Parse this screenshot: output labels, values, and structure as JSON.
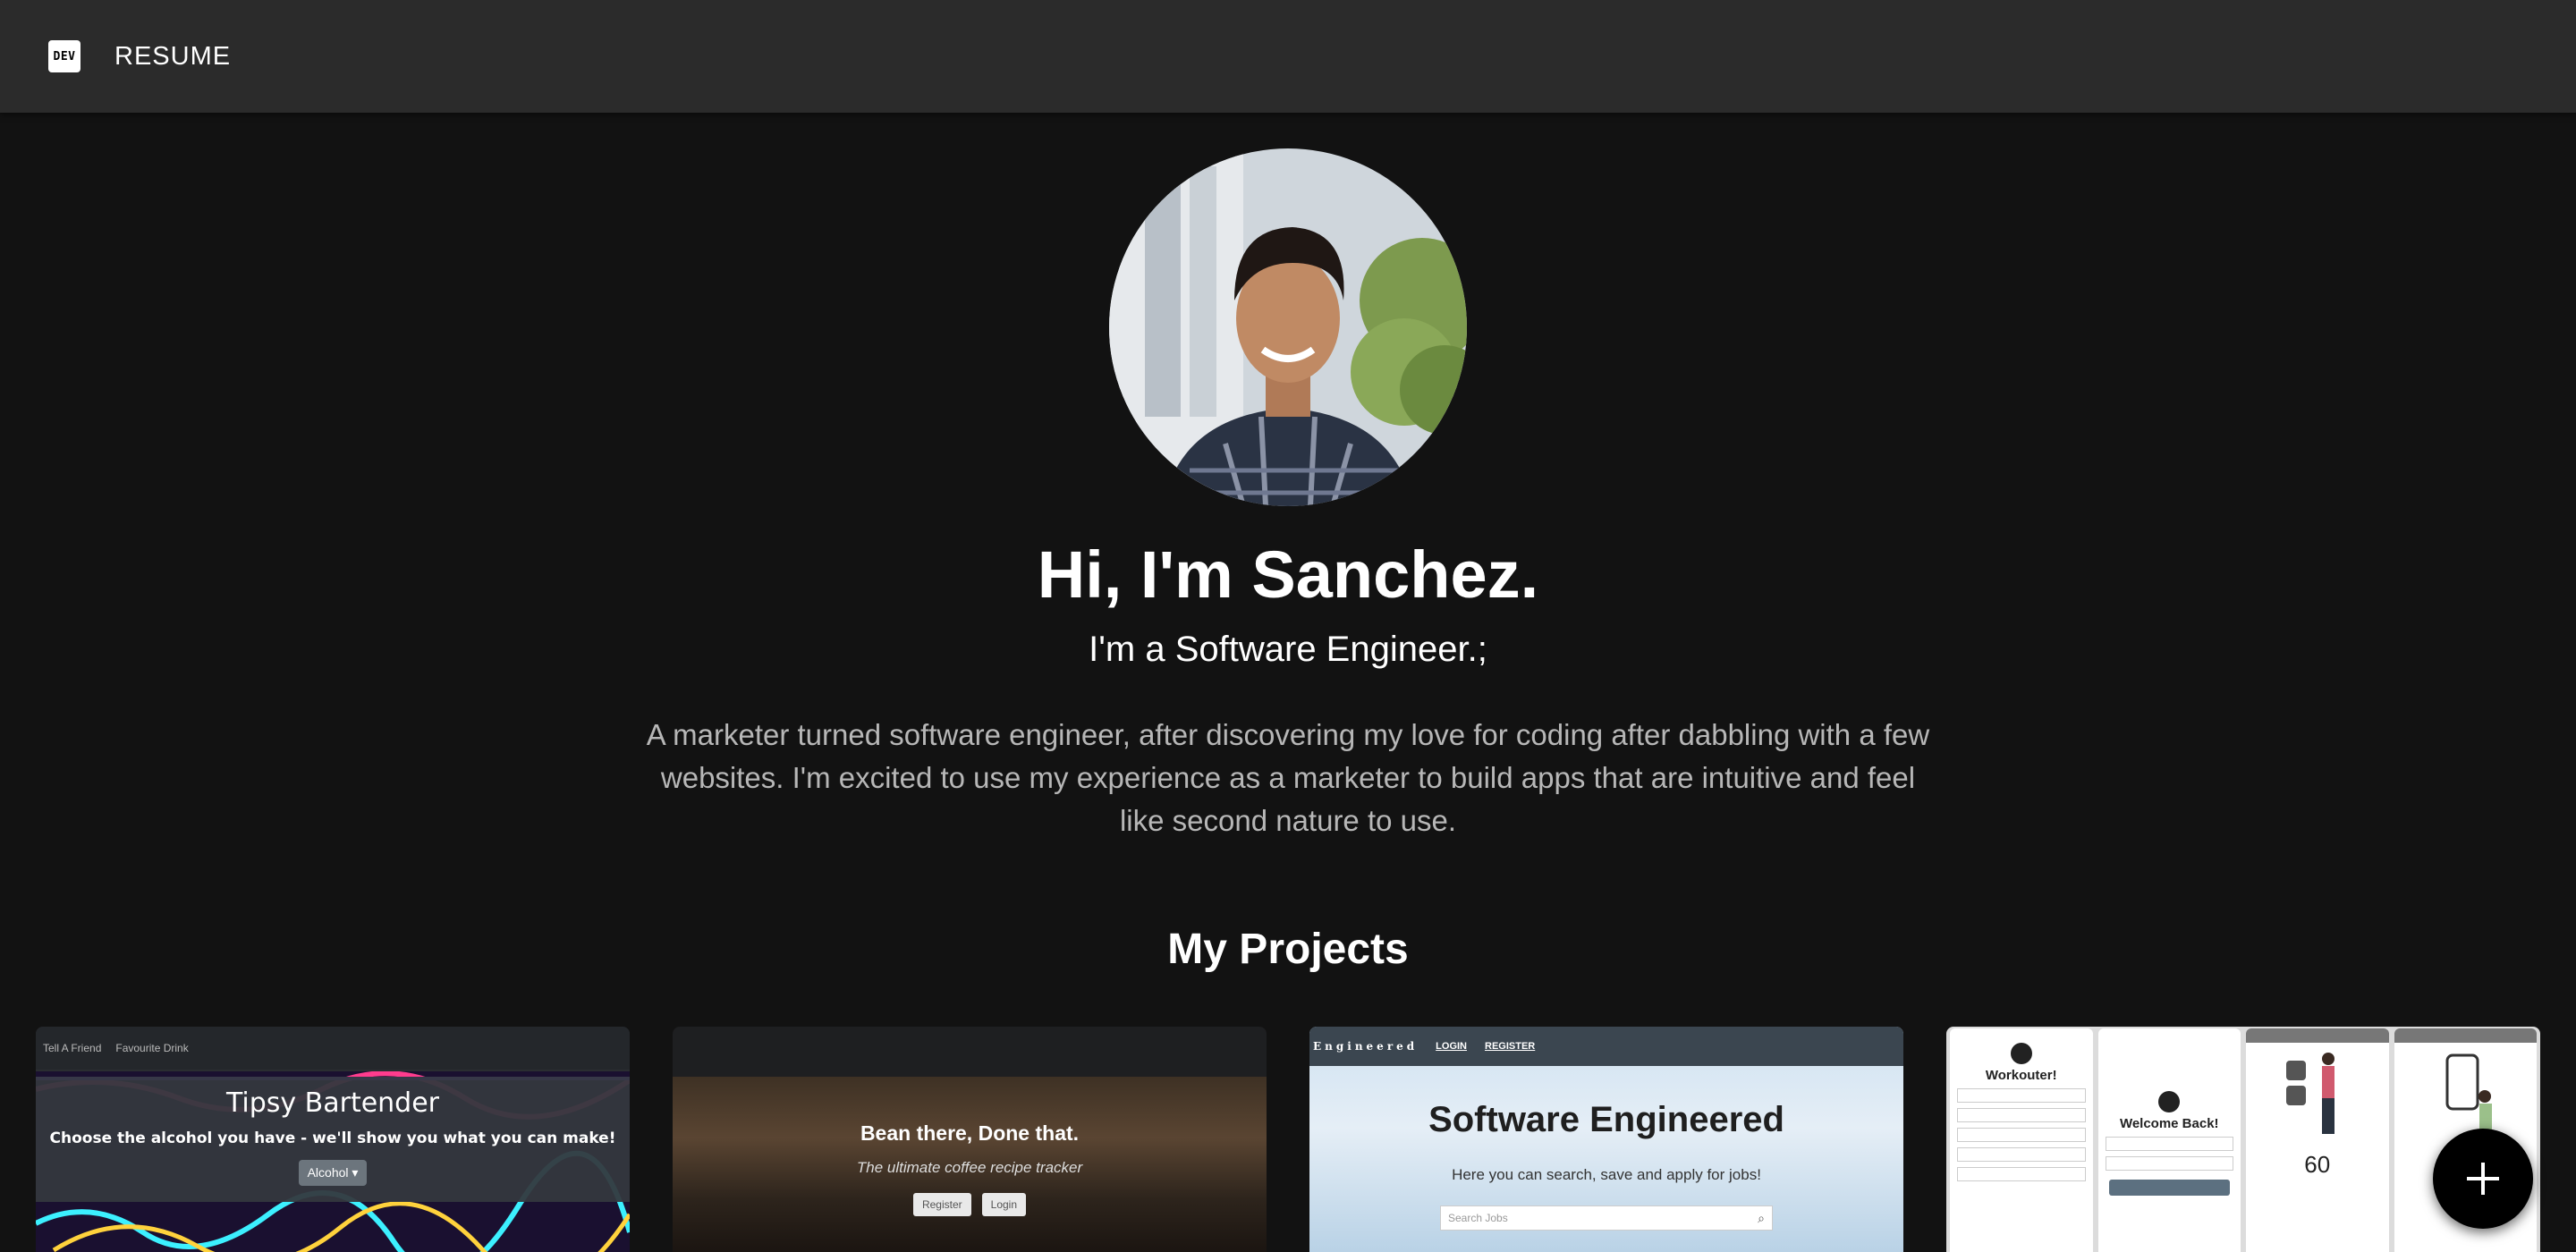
{
  "header": {
    "logo_text": "DEV",
    "title": "RESUME"
  },
  "profile": {
    "avatar_alt": "Profile photo",
    "greeting": "Hi, I'm Sanchez.",
    "role": "I'm a Software Engineer.;",
    "bio": "A marketer turned software engineer, after discovering my love for coding after dabbling with a few websites. I'm excited to use my experience as a marketer to build apps that are intuitive and feel like second nature to use."
  },
  "projects": {
    "heading": "My Projects",
    "items": [
      {
        "nav": [
          "Tell A Friend",
          "Favourite Drink"
        ],
        "title": "Tipsy Bartender",
        "subtitle": "Choose the alcohol you have - we'll show you what you can make!",
        "dropdown": "Alcohol"
      },
      {
        "title": "Bean there, Done that.",
        "subtitle": "The ultimate coffee recipe tracker",
        "buttons": [
          "Register",
          "Login"
        ]
      },
      {
        "brand": "Engineered",
        "nav": [
          "LOGIN",
          "REGISTER"
        ],
        "title": "Software Engineered",
        "subtitle": "Here you can search, save and apply for jobs!",
        "search_placeholder": "Search Jobs"
      },
      {
        "screen1_title": "Workouter!",
        "screen2_title": "Welcome Back!",
        "counter": "60"
      }
    ]
  },
  "fab": {
    "icon": "plus-icon"
  }
}
